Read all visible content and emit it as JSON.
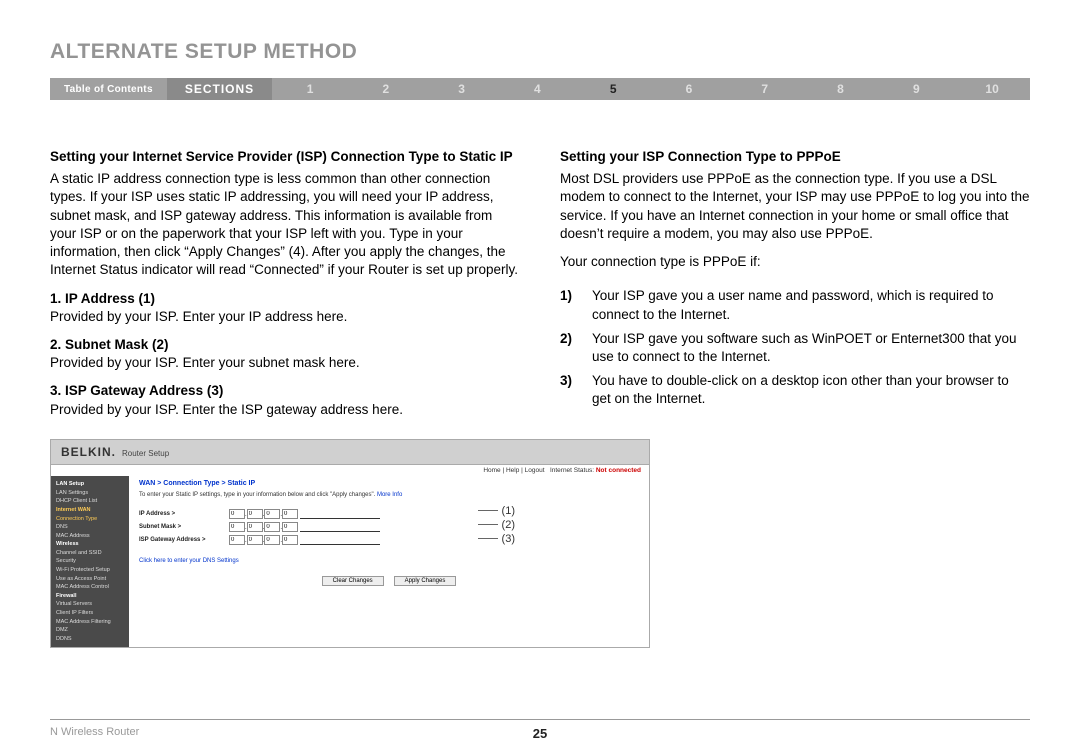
{
  "page_title": "ALTERNATE SETUP METHOD",
  "nav": {
    "toc": "Table of Contents",
    "sections_label": "SECTIONS",
    "items": [
      "1",
      "2",
      "3",
      "4",
      "5",
      "6",
      "7",
      "8",
      "9",
      "10"
    ],
    "active": "5"
  },
  "left": {
    "heading": "Setting your Internet Service Provider (ISP) Connection Type to Static IP",
    "para": "A static IP address connection type is less common than other connection types. If your ISP uses static IP addressing, you will need your IP address, subnet mask, and ISP gateway address. This information is available from your ISP or on the paperwork that your ISP left with you. Type in your information, then click “Apply Changes” (4). After you apply the changes, the Internet Status indicator will read “Connected” if your Router is set up properly.",
    "fields": [
      {
        "label": "1.  IP Address (1)",
        "desc": "Provided by your ISP. Enter your IP address here."
      },
      {
        "label": "2.  Subnet Mask (2)",
        "desc": "Provided by your ISP. Enter your subnet mask here."
      },
      {
        "label": "3.  ISP Gateway Address (3)",
        "desc": "Provided by your ISP. Enter the ISP gateway address here."
      }
    ]
  },
  "right": {
    "heading": "Setting your ISP Connection Type to PPPoE",
    "para": "Most DSL providers use PPPoE as the connection type. If you use a DSL modem to connect to the Internet, your ISP may use PPPoE to log you into the service. If you have an Internet connection in your home or small office that doesn’t require a modem, you may also use PPPoE.",
    "para2": "Your connection type is PPPoE if:",
    "list": [
      {
        "num": "1)",
        "text": "Your ISP gave you a user name and password, which is required to connect to the Internet."
      },
      {
        "num": "2)",
        "text": "Your ISP gave you software such as WinPOET or Enternet300 that you use to connect to the Internet."
      },
      {
        "num": "3)",
        "text": "You have to double-click on a desktop icon other than your browser to get on the Internet."
      }
    ]
  },
  "router": {
    "brand": "BELKIN.",
    "subtitle": "Router Setup",
    "status_links": "Home | Help | Logout",
    "status_label": "Internet Status:",
    "status_value": "Not connected",
    "side": {
      "lan_setup": "LAN Setup",
      "lan_settings": "LAN Settings",
      "dhcp": "DHCP Client List",
      "internet_wan": "Internet WAN",
      "conn_type": "Connection Type",
      "dns": "DNS",
      "mac": "MAC Address",
      "wireless": "Wireless",
      "channel": "Channel and SSID",
      "security": "Security",
      "wps": "Wi-Fi Protected Setup",
      "ap": "Use as Access Point",
      "maccontrol": "MAC Address Control",
      "firewall": "Firewall",
      "vservers": "Virtual Servers",
      "ipfilters": "Client IP Filters",
      "macfilter": "MAC Address Filtering",
      "dmz": "DMZ",
      "ddns": "DDNS"
    },
    "breadcrumb": "WAN > Connection Type > Static IP",
    "instr": "To enter your Static IP settings, type in your information below and click \"Apply changes\".",
    "moreinfo": "More Info",
    "field_labels": {
      "ip": "IP Address >",
      "subnet": "Subnet Mask >",
      "gateway": "ISP Gateway Address >"
    },
    "dns_link": "Click here to enter your DNS Settings",
    "buttons": {
      "clear": "Clear Changes",
      "apply": "Apply Changes"
    },
    "callouts": {
      "c1": "(1)",
      "c2": "(2)",
      "c3": "(3)"
    }
  },
  "footer": {
    "left": "N Wireless Router",
    "page": "25"
  }
}
